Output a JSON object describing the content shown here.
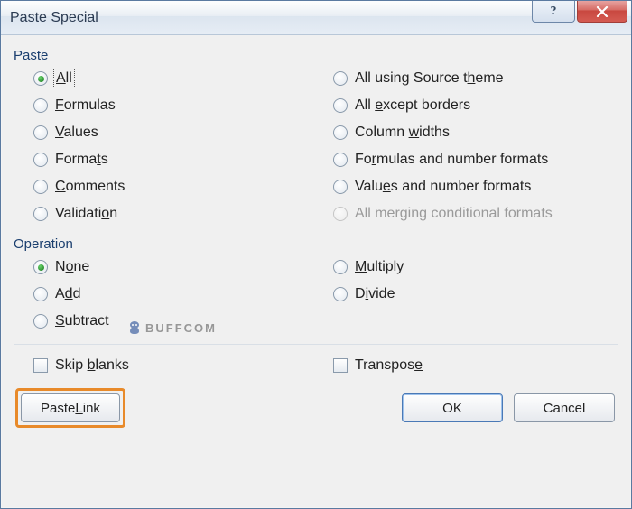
{
  "title": "Paste Special",
  "groups": {
    "paste": {
      "label": "Paste",
      "left": [
        {
          "text": "All",
          "u": 0,
          "checked": true,
          "focused": true
        },
        {
          "text": "Formulas",
          "u": 0
        },
        {
          "text": "Values",
          "u": 0
        },
        {
          "text": "Formats",
          "u": 5
        },
        {
          "text": "Comments",
          "u": 0
        },
        {
          "text": "Validation",
          "u": 8
        }
      ],
      "right": [
        {
          "text": "All using Source theme",
          "u": 18
        },
        {
          "text": "All except borders",
          "u": 4
        },
        {
          "text": "Column widths",
          "u": 7
        },
        {
          "text": "Formulas and number formats",
          "u": 2
        },
        {
          "text": "Values and number formats",
          "u": 4
        },
        {
          "text": "All merging conditional formats",
          "u": -1,
          "disabled": true
        }
      ]
    },
    "operation": {
      "label": "Operation",
      "left": [
        {
          "text": "None",
          "u": 1,
          "checked": true
        },
        {
          "text": "Add",
          "u": 1
        },
        {
          "text": "Subtract",
          "u": 0
        }
      ],
      "right": [
        {
          "text": "Multiply",
          "u": 0
        },
        {
          "text": "Divide",
          "u": 1
        }
      ]
    }
  },
  "checks": {
    "skip_blanks": {
      "text": "Skip blanks",
      "u": 5
    },
    "transpose": {
      "text": "Transpose",
      "u": 8
    }
  },
  "buttons": {
    "paste_link": {
      "text": "Paste Link",
      "u": 6
    },
    "ok": "OK",
    "cancel": "Cancel"
  },
  "watermark": "BUFFCOM"
}
